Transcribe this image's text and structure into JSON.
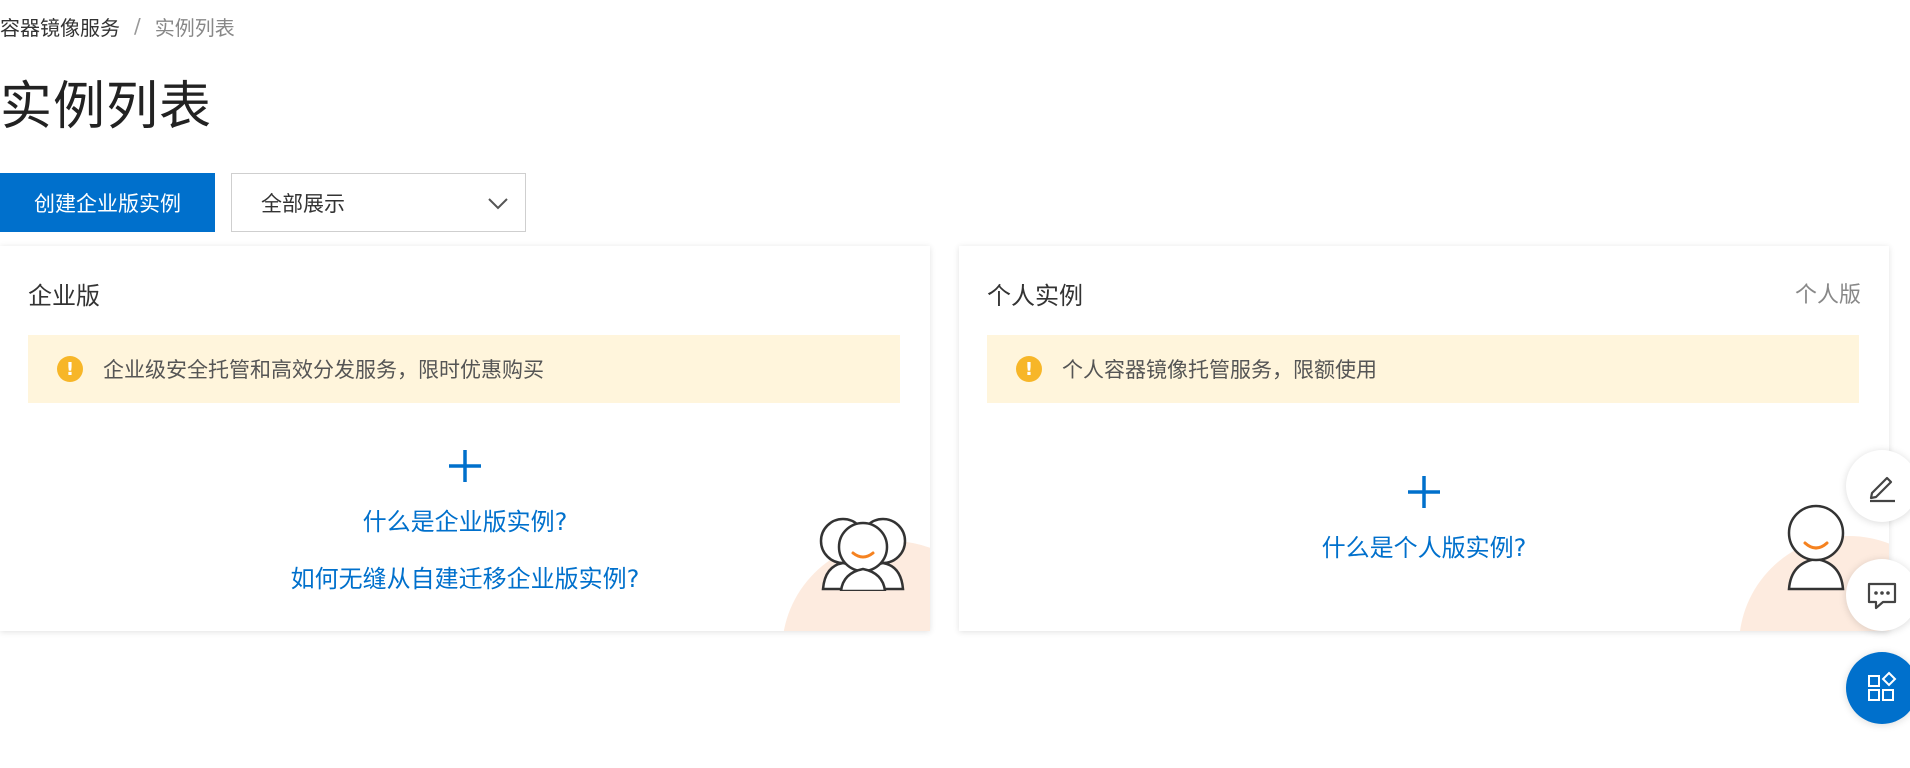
{
  "breadcrumb": {
    "parent": "容器镜像服务",
    "separator": "/",
    "current": "实例列表"
  },
  "page": {
    "title": "实例列表"
  },
  "toolbar": {
    "create_button": "创建企业版实例",
    "filter_select": {
      "value": "全部展示"
    }
  },
  "cards": {
    "enterprise": {
      "title": "企业版",
      "notice": "企业级安全托管和高效分发服务，限时优惠购买",
      "links": [
        "什么是企业版实例?",
        "如何无缝从自建迁移企业版实例?"
      ]
    },
    "personal": {
      "title": "个人实例",
      "tag": "个人版",
      "notice": "个人容器镜像托管服务，限额使用",
      "links": [
        "什么是个人版实例?"
      ]
    }
  },
  "colors": {
    "primary": "#0070cc",
    "notice_bg": "#fff5dc",
    "warning_icon": "#f7b628",
    "smile": "#f58220",
    "deco": "#fdebdf"
  },
  "icons": {
    "dropdown": "chevron-down-icon",
    "warning": "warning-icon",
    "add": "plus-icon",
    "edit": "edit-icon",
    "feedback": "chat-icon",
    "apps": "apps-icon"
  }
}
